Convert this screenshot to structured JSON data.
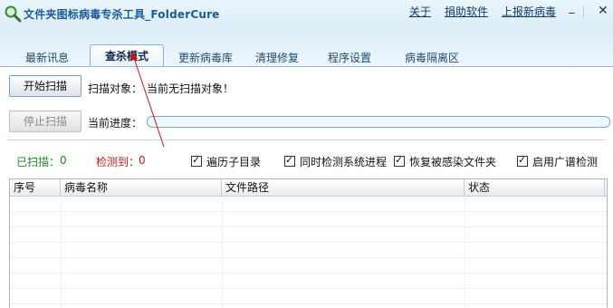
{
  "window": {
    "title": "文件夹图标病毒专杀工具_FolderCure",
    "links": {
      "about": "关于",
      "donate": "捐助软件",
      "report": "上报新病毒"
    },
    "min_glyph": "_",
    "close_glyph": "✕"
  },
  "tabs": [
    {
      "label": "最新讯息"
    },
    {
      "label": "查杀模式"
    },
    {
      "label": "更新病毒库"
    },
    {
      "label": "清理修复"
    },
    {
      "label": "程序设置"
    },
    {
      "label": "病毒隔离区"
    }
  ],
  "active_tab": 1,
  "scan": {
    "start_label": "开始扫描",
    "stop_label": "停止扫描",
    "target_label": "扫描对象：",
    "target_value": "当前无扫描对象！",
    "progress_label": "当前进度：",
    "progress": 0
  },
  "stats": {
    "scanned_label": "已扫描：",
    "scanned_value": "0",
    "detected_label": "检测到：",
    "detected_value": "0"
  },
  "options": [
    {
      "label": "遍历子目录",
      "checked": true
    },
    {
      "label": "同时检测系统进程",
      "checked": true
    },
    {
      "label": "恢复被感染文件夹",
      "checked": true
    },
    {
      "label": "启用广谱检测",
      "checked": true
    }
  ],
  "table": {
    "columns": [
      "序号",
      "病毒名称",
      "文件路径",
      "状态"
    ],
    "rows": []
  },
  "colors": {
    "accent": "#1a5a9a",
    "scanned": "#1e8a1e",
    "detected": "#c41a1a",
    "annotation": "#cc1111"
  },
  "icons": {
    "app": "magnifier-icon",
    "arrow": "annotation-arrow"
  }
}
